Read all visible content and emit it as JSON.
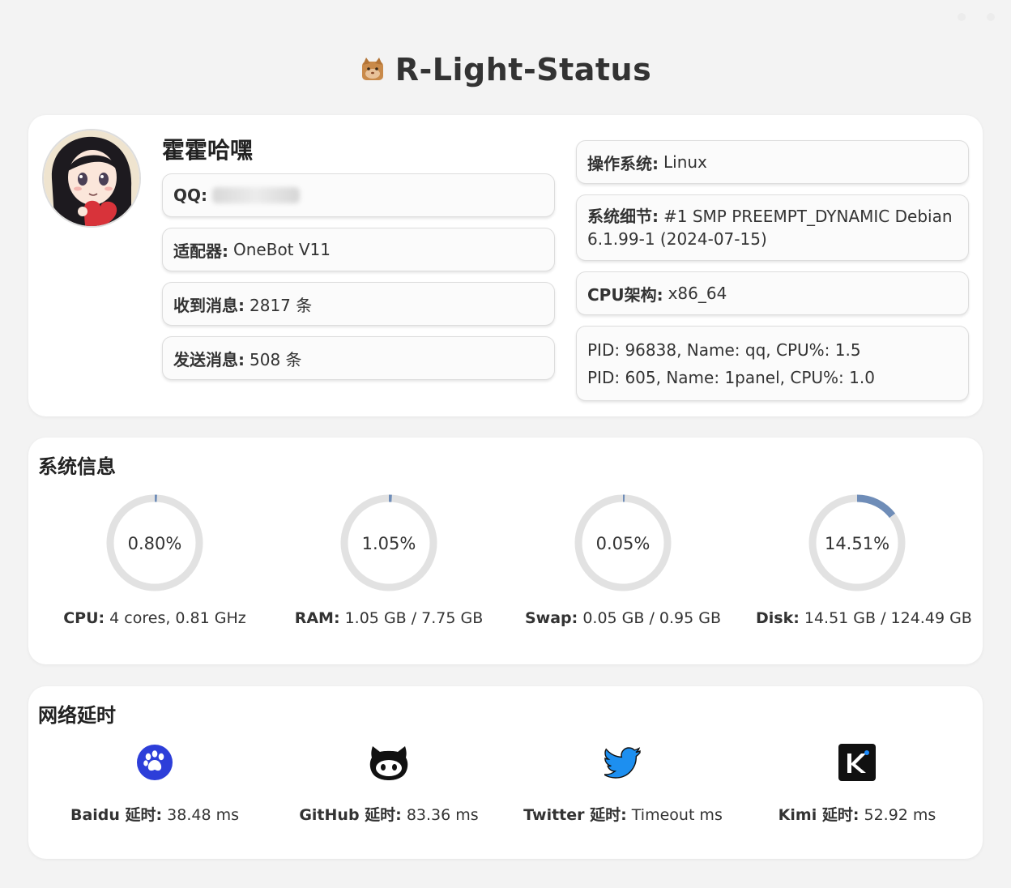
{
  "window": {
    "title": "R-Light-Status",
    "logo_icon": "cat-face-icon"
  },
  "profile": {
    "username": "霍霍哈嘿",
    "avatar_icon": "anime-girl-avatar",
    "qq": {
      "label": "QQ:",
      "value": ""
    },
    "adapter": {
      "label": "适配器:",
      "value": "OneBot V11"
    },
    "received": {
      "label": "收到消息:",
      "value": "2817 条"
    },
    "sent": {
      "label": "发送消息:",
      "value": "508 条"
    }
  },
  "system": {
    "os": {
      "label": "操作系统:",
      "value": "Linux"
    },
    "kernel": {
      "label": "系统细节:",
      "value": "#1 SMP PREEMPT_DYNAMIC Debian 6.1.99-1 (2024-07-15)"
    },
    "arch": {
      "label": "CPU架构:",
      "value": "x86_64"
    },
    "processes": [
      "PID: 96838, Name: qq, CPU%: 1.5",
      "PID: 605, Name: 1panel, CPU%: 1.0"
    ]
  },
  "sysinfo": {
    "title": "系统信息",
    "gauges": [
      {
        "percent_text": "0.80%",
        "percent": 0.8,
        "label": "CPU:",
        "value": "4 cores, 0.81 GHz"
      },
      {
        "percent_text": "1.05%",
        "percent": 1.05,
        "label": "RAM:",
        "value": "1.05 GB / 7.75 GB"
      },
      {
        "percent_text": "0.05%",
        "percent": 0.05,
        "label": "Swap:",
        "value": "0.05 GB / 0.95 GB"
      },
      {
        "percent_text": "14.51%",
        "percent": 14.51,
        "label": "Disk:",
        "value": "14.51 GB / 124.49 GB"
      }
    ],
    "colors": {
      "track": "#e2e2e2",
      "fill": "#6f8db8"
    }
  },
  "network": {
    "title": "网络延时",
    "items": [
      {
        "icon": "baidu-paw-icon",
        "label": "Baidu 延时:",
        "value": "38.48 ms"
      },
      {
        "icon": "github-octocat-icon",
        "label": "GitHub 延时:",
        "value": "83.36 ms"
      },
      {
        "icon": "twitter-bird-icon",
        "label": "Twitter 延时:",
        "value": "Timeout ms"
      },
      {
        "icon": "kimi-k-icon",
        "label": "Kimi 延时:",
        "value": "52.92 ms"
      }
    ]
  }
}
